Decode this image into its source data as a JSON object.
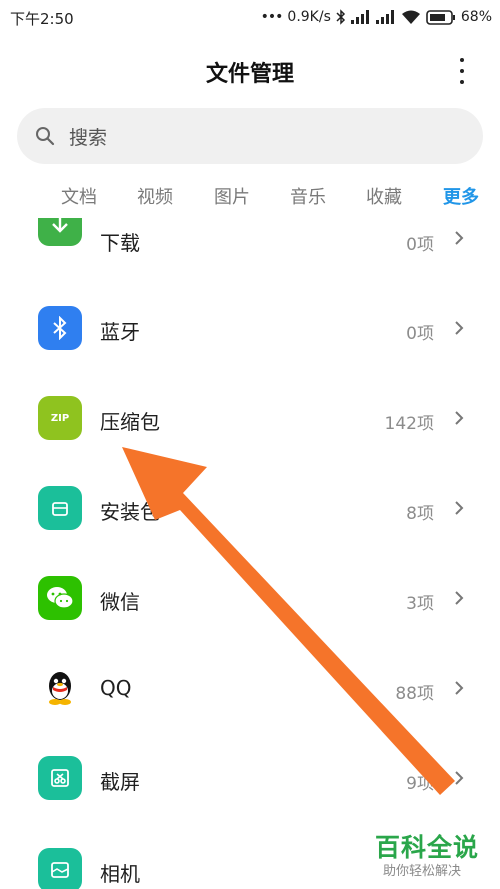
{
  "status_bar": {
    "time": "下午2:50",
    "network_speed": "0.9K/s",
    "battery": "68%"
  },
  "header": {
    "title": "文件管理"
  },
  "search": {
    "placeholder": "搜索"
  },
  "tabs": [
    {
      "label": "文档",
      "active": false
    },
    {
      "label": "视频",
      "active": false
    },
    {
      "label": "图片",
      "active": false
    },
    {
      "label": "音乐",
      "active": false
    },
    {
      "label": "收藏",
      "active": false
    },
    {
      "label": "更多",
      "active": true
    }
  ],
  "categories": [
    {
      "label": "下载",
      "count": "0项",
      "icon": "download-icon",
      "color": "#3fb148"
    },
    {
      "label": "蓝牙",
      "count": "0项",
      "icon": "bluetooth-icon",
      "color": "#2f7ff0"
    },
    {
      "label": "压缩包",
      "count": "142项",
      "icon": "zip-icon",
      "color": "#8fc31f"
    },
    {
      "label": "安装包",
      "count": "8项",
      "icon": "apk-icon",
      "color": "#1bbf9a"
    },
    {
      "label": "微信",
      "count": "3项",
      "icon": "wechat-icon",
      "color": "#2dc100"
    },
    {
      "label": "QQ",
      "count": "88项",
      "icon": "qq-icon",
      "color": "#000000"
    },
    {
      "label": "截屏",
      "count": "9项",
      "icon": "screenshot-icon",
      "color": "#1bbf9a"
    },
    {
      "label": "相机",
      "count": "",
      "icon": "camera-icon",
      "color": "#1bbf9a"
    }
  ],
  "zip_icon_text": "ZIP",
  "watermark": {
    "title": "百科全说",
    "subtitle": "助你轻松解决"
  },
  "annotation": {
    "color": "#f5742a"
  }
}
